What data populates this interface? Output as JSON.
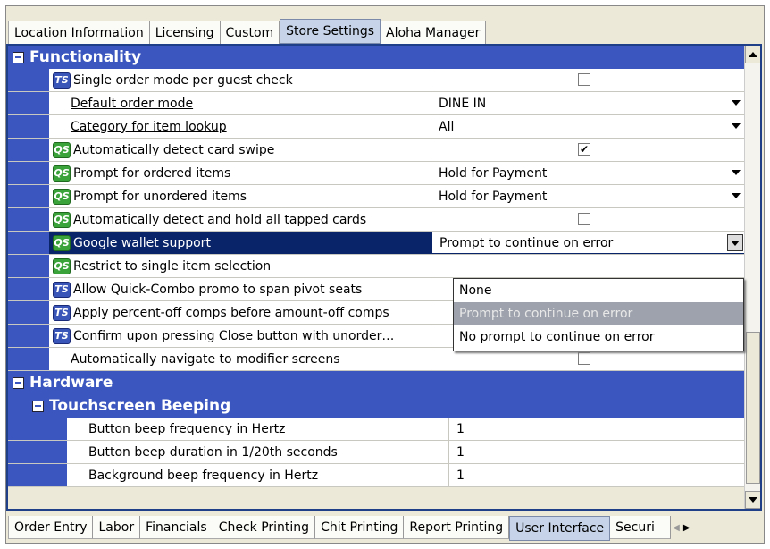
{
  "top_tabs": [
    "Location Information",
    "Licensing",
    "Custom",
    "Store Settings",
    "Aloha Manager"
  ],
  "top_tabs_active": "Store Settings",
  "sections": {
    "functionality": "Functionality",
    "hardware": "Hardware",
    "touchscreen_beeping": "Touchscreen Beeping"
  },
  "badges": {
    "ts": "TS",
    "qs": "QS"
  },
  "properties": [
    {
      "label": "Single order mode per guest check",
      "badge": "TS",
      "type": "checkbox",
      "checked": false
    },
    {
      "label": "Default order mode",
      "badge": "",
      "underline": true,
      "type": "dropdown",
      "value": "DINE IN"
    },
    {
      "label": "Category for item lookup",
      "badge": "",
      "underline": true,
      "type": "dropdown",
      "value": "All"
    },
    {
      "label": "Automatically detect card swipe",
      "badge": "QS",
      "type": "checkbox",
      "checked": true
    },
    {
      "label": "Prompt for ordered items",
      "badge": "QS",
      "type": "dropdown",
      "value": "Hold for Payment"
    },
    {
      "label": "Prompt for unordered items",
      "badge": "QS",
      "type": "dropdown",
      "value": "Hold for Payment"
    },
    {
      "label": "Automatically detect and hold all tapped cards",
      "badge": "QS",
      "type": "checkbox",
      "checked": false
    },
    {
      "label": "Google wallet support",
      "badge": "QS",
      "type": "dropdown-open",
      "value": "Prompt to continue on error",
      "selected": true
    },
    {
      "label": "Restrict to single item selection",
      "badge": "QS",
      "type": "hidden"
    },
    {
      "label": "Allow Quick-Combo promo to span pivot seats",
      "badge": "TS",
      "type": "hidden"
    },
    {
      "label": "Apply percent-off comps before amount-off comps",
      "badge": "TS",
      "type": "hidden"
    },
    {
      "label": "Confirm upon pressing Close button with unorder…",
      "badge": "TS",
      "type": "checkbox",
      "checked": false
    },
    {
      "label": "Automatically navigate to modifier screens",
      "badge": "",
      "type": "checkbox",
      "checked": false
    }
  ],
  "dropdown_options": [
    "None",
    "Prompt to continue on error",
    "No prompt to continue on error"
  ],
  "dropdown_highlighted": "Prompt to continue on error",
  "beeping_properties": [
    {
      "label": "Button beep frequency in Hertz",
      "value": "1"
    },
    {
      "label": "Button beep duration in 1/20th seconds",
      "value": "1"
    },
    {
      "label": "Background beep frequency in Hertz",
      "value": "1"
    }
  ],
  "bottom_tabs": [
    "Order Entry",
    "Labor",
    "Financials",
    "Check Printing",
    "Chit Printing",
    "Report Printing",
    "User Interface",
    "Securi"
  ],
  "bottom_tabs_active": "User Interface",
  "checkmark": "✔",
  "tab_nav": {
    "left": "◀",
    "right": "▶"
  }
}
